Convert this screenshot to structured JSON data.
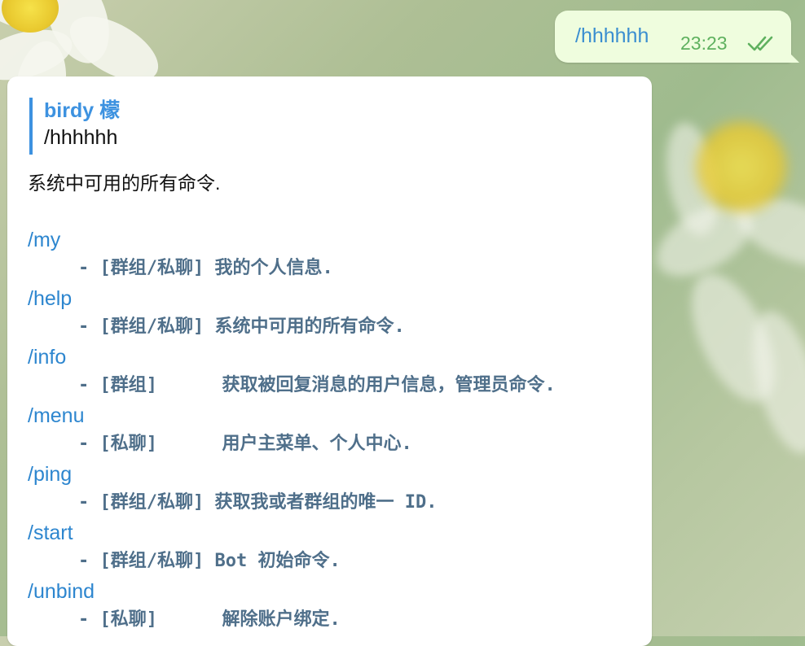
{
  "outgoing": {
    "text": "/hhhhhh",
    "time": "23:23",
    "status_icon": "double-check-icon",
    "color_text": "#3a8ed0",
    "color_time": "#5fb15f"
  },
  "incoming": {
    "reply": {
      "name": "birdy 檬",
      "text": "/hhhhhh"
    },
    "intro": "系统中可用的所有命令.",
    "commands": [
      {
        "cmd": "/my",
        "desc": "- [群组/私聊] 我的个人信息."
      },
      {
        "cmd": "/help",
        "desc": "- [群组/私聊] 系统中可用的所有命令."
      },
      {
        "cmd": "/info",
        "desc": "- [群组]      获取被回复消息的用户信息，管理员命令."
      },
      {
        "cmd": "/menu",
        "desc": "- [私聊]      用户主菜单、个人中心."
      },
      {
        "cmd": "/ping",
        "desc": "- [群组/私聊] 获取我或者群组的唯一 ID."
      },
      {
        "cmd": "/start",
        "desc": "- [群组/私聊] Bot 初始命令."
      },
      {
        "cmd": "/unbind",
        "desc": "- [私聊]      解除账户绑定."
      }
    ]
  },
  "colors": {
    "link": "#2d86cf",
    "reply_accent": "#3d92e0",
    "desc": "#4f6f8a"
  }
}
